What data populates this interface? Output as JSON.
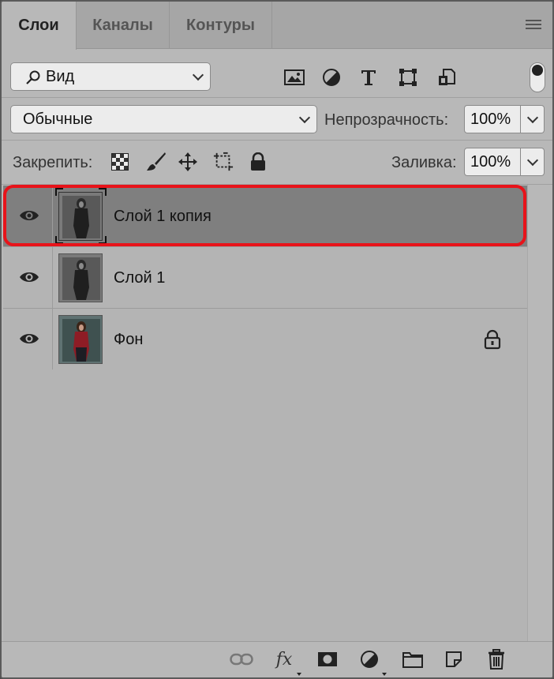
{
  "tabs": [
    {
      "label": "Слои",
      "active": true
    },
    {
      "label": "Каналы",
      "active": false
    },
    {
      "label": "Контуры",
      "active": false
    }
  ],
  "filter": {
    "value": "Вид",
    "icons": [
      "image-filter-icon",
      "adjustment-filter-icon",
      "type-filter-icon",
      "shape-filter-icon",
      "smart-object-filter-icon"
    ]
  },
  "blend_mode": {
    "value": "Обычные"
  },
  "opacity": {
    "label": "Непрозрачность:",
    "value": "100%"
  },
  "lock": {
    "label": "Закрепить:",
    "icons": [
      "lock-transparent-icon",
      "lock-image-icon",
      "lock-position-icon",
      "lock-artboard-icon",
      "lock-all-icon"
    ]
  },
  "fill": {
    "label": "Заливка:",
    "value": "100%"
  },
  "layers": [
    {
      "name": "Слой 1 копия",
      "selected": true,
      "visible": true,
      "locked": false,
      "color": false
    },
    {
      "name": "Слой 1",
      "selected": false,
      "visible": true,
      "locked": false,
      "color": false
    },
    {
      "name": "Фон",
      "selected": false,
      "visible": true,
      "locked": true,
      "color": true
    }
  ],
  "highlight_color": "#e8131a",
  "bottom_icons": [
    "link-layers-icon",
    "fx-icon",
    "layer-mask-icon",
    "adjustment-layer-icon",
    "group-folder-icon",
    "new-layer-icon",
    "trash-icon"
  ]
}
